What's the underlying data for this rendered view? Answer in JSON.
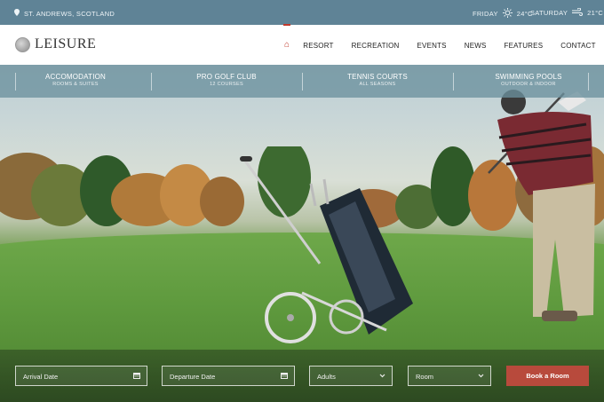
{
  "topbar": {
    "location": "ST. ANDREWS, SCOTLAND",
    "weather": [
      {
        "day": "FRIDAY",
        "icon": "sun-icon",
        "temp": "24°C"
      },
      {
        "day": "SATURDAY",
        "icon": "wind-icon",
        "temp": "21°C"
      }
    ]
  },
  "brand": {
    "name": "LEISURE"
  },
  "nav": {
    "home_icon": "home-icon",
    "items": [
      "RESORT",
      "RECREATION",
      "EVENTS",
      "NEWS",
      "FEATURES",
      "CONTACT"
    ],
    "search_icon": "search-icon"
  },
  "features": [
    {
      "title": "ACCOMODATION",
      "subtitle": "ROOMS & SUITES"
    },
    {
      "title": "PRO GOLF CLUB",
      "subtitle": "12 COURSES"
    },
    {
      "title": "TENNIS COURTS",
      "subtitle": "ALL SEASONS"
    },
    {
      "title": "SWIMMING POOLS",
      "subtitle": "OUTDOOR & INDOOR"
    }
  ],
  "booking": {
    "arrival_placeholder": "Arrival Date",
    "departure_placeholder": "Departure Date",
    "adults_label": "Adults",
    "room_label": "Room",
    "book_label": "Book a Room"
  },
  "colors": {
    "accent": "#b84a3c",
    "topbar": "#5f8396",
    "feature_strip": "#6c919e"
  }
}
